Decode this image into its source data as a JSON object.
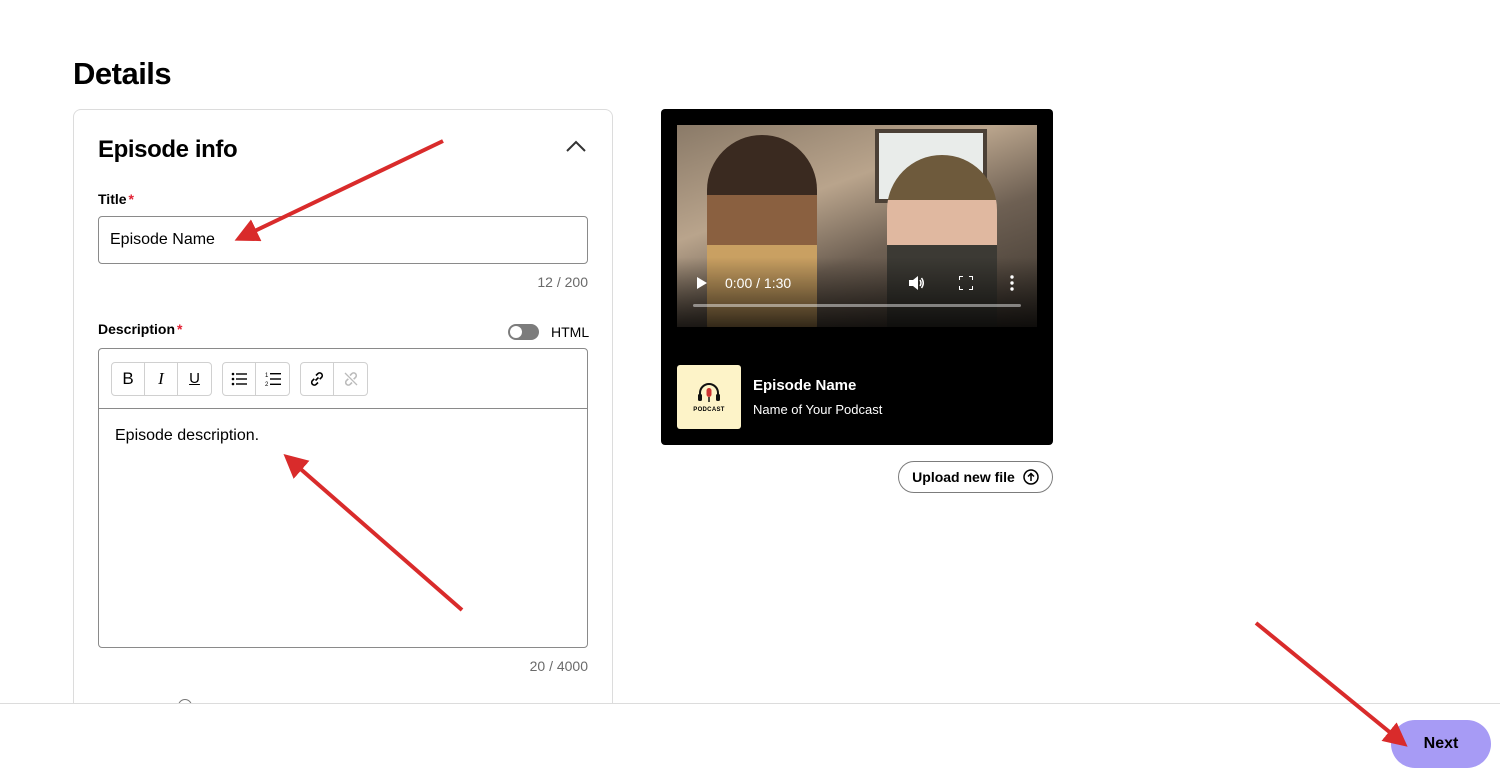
{
  "page": {
    "title": "Details"
  },
  "episode_info": {
    "section_title": "Episode info",
    "title_field": {
      "label": "Title",
      "required_mark": "*",
      "value": "Episode Name",
      "counter": "12 / 200"
    },
    "description_field": {
      "label": "Description",
      "required_mark": "*",
      "html_toggle_label": "HTML",
      "html_toggle_on": false,
      "text": "Episode description.",
      "counter": "20 / 4000"
    },
    "toolbar": {
      "bold": "B",
      "italic": "I",
      "underline": "U",
      "bullet_list_icon": "bullet-list-icon",
      "numbered_list_icon": "numbered-list-icon",
      "link_icon": "link-icon",
      "unlink_icon": "unlink-icon"
    }
  },
  "preview": {
    "time": "0:00 / 1:30",
    "progress": 0,
    "episode_name": "Episode Name",
    "podcast_name": "Name of Your Podcast",
    "artwork_label": "PODCAST",
    "upload_label": "Upload new file"
  },
  "footer": {
    "next_label": "Next",
    "next_color": "#a79bf5"
  },
  "colors": {
    "required": "#e22134",
    "annotation_arrow": "#d92b2b"
  }
}
